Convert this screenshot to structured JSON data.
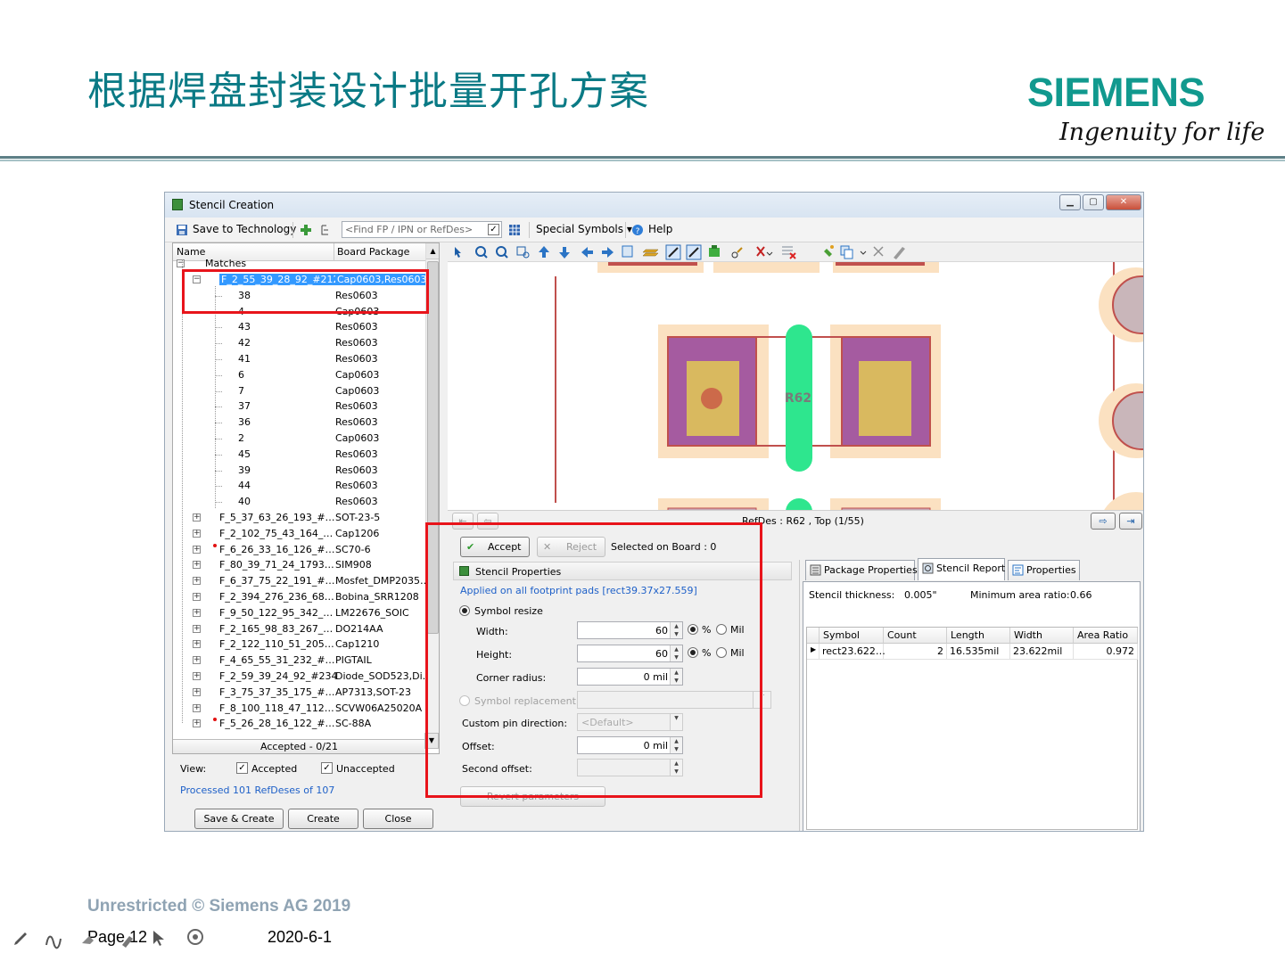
{
  "slide": {
    "title": "根据焊盘封装设计批量开孔方案",
    "logo": "SIEMENS",
    "tagline": "Ingenuity for life",
    "copyright": "Unrestricted © Siemens AG 2019",
    "page": "Page 12",
    "date": "2020-6-1"
  },
  "window": {
    "title": "Stencil Creation",
    "toolbar": {
      "save_tech": "Save to Technology",
      "find_placeholder": "<Find FP / IPN or RefDes>",
      "special_symbols": "Special Symbols",
      "help": "Help"
    }
  },
  "tree": {
    "col_name": "Name",
    "col_pkg": "Board Package",
    "root": "Matches",
    "selected": {
      "name": "F_2_55_39_28_92_#212",
      "pkg": "Cap0603,Res0603"
    },
    "children": [
      {
        "name": "38",
        "pkg": "Res0603"
      },
      {
        "name": "4",
        "pkg": "Cap0603"
      },
      {
        "name": "43",
        "pkg": "Res0603"
      },
      {
        "name": "42",
        "pkg": "Res0603"
      },
      {
        "name": "41",
        "pkg": "Res0603"
      },
      {
        "name": "6",
        "pkg": "Cap0603"
      },
      {
        "name": "7",
        "pkg": "Cap0603"
      },
      {
        "name": "37",
        "pkg": "Res0603"
      },
      {
        "name": "36",
        "pkg": "Res0603"
      },
      {
        "name": "2",
        "pkg": "Cap0603"
      },
      {
        "name": "45",
        "pkg": "Res0603"
      },
      {
        "name": "39",
        "pkg": "Res0603"
      },
      {
        "name": "44",
        "pkg": "Res0603"
      },
      {
        "name": "40",
        "pkg": "Res0603"
      }
    ],
    "groups": [
      {
        "name": "F_5_37_63_26_193_#…",
        "pkg": "SOT-23-5",
        "flag": false
      },
      {
        "name": "F_2_102_75_43_164_…",
        "pkg": "Cap1206",
        "flag": false
      },
      {
        "name": "F_6_26_33_16_126_#…",
        "pkg": "SC70-6",
        "flag": true
      },
      {
        "name": "F_80_39_71_24_1793…",
        "pkg": "SIM908",
        "flag": false
      },
      {
        "name": "F_6_37_75_22_191_#…",
        "pkg": "Mosfet_DMP2035…",
        "flag": false
      },
      {
        "name": "F_2_394_276_236_68…",
        "pkg": "Bobina_SRR1208",
        "flag": false
      },
      {
        "name": "F_9_50_122_95_342_…",
        "pkg": "LM22676_SOIC",
        "flag": false
      },
      {
        "name": "F_2_165_98_83_267_…",
        "pkg": "DO214AA",
        "flag": false
      },
      {
        "name": "F_2_122_110_51_205…",
        "pkg": "Cap1210",
        "flag": false
      },
      {
        "name": "F_4_65_55_31_232_#…",
        "pkg": "PIGTAIL",
        "flag": false
      },
      {
        "name": "F_2_59_39_24_92_#234",
        "pkg": "Diode_SOD523,Di…",
        "flag": false
      },
      {
        "name": "F_3_75_37_35_175_#…",
        "pkg": "AP7313,SOT-23",
        "flag": false
      },
      {
        "name": "F_8_100_118_47_112…",
        "pkg": "SCVW06A25020A",
        "flag": false
      },
      {
        "name": "F_5_26_28_16_122_#…",
        "pkg": "SC-88A",
        "flag": true
      }
    ],
    "footer": "Accepted - 0/21"
  },
  "view": {
    "label": "View:",
    "accepted": "Accepted",
    "unaccepted": "Unaccepted",
    "processed": "Processed 101 RefDeses of 107"
  },
  "buttons": {
    "save_create": "Save & Create",
    "create": "Create",
    "close": "Close",
    "accept": "Accept",
    "reject": "Reject",
    "revert": "Revert parameters"
  },
  "canvas": {
    "refdes_label": "R62",
    "nav_text": "RefDes : R62 , Top (1/55)",
    "colors": {
      "pad": "#a55ba0",
      "paste": "#d9b95f",
      "outline": "#fbe1c1",
      "trace": "#2ee68e",
      "board_edge": "#c0504d"
    }
  },
  "action_bar": {
    "selected_on_board": "Selected on Board : 0"
  },
  "stencil_props": {
    "header": "Stencil Properties",
    "applied": "Applied on all footprint pads [rect39.37x27.559]",
    "symbol_resize": "Symbol resize",
    "width_label": "Width:",
    "width_value": "60",
    "height_label": "Height:",
    "height_value": "60",
    "unit_pct": "%",
    "unit_mil": "Mil",
    "corner_label": "Corner radius:",
    "corner_value": "0 mil",
    "symbol_replacement": "Symbol replacement",
    "custom_pin_label": "Custom pin direction:",
    "custom_pin_value": "<Default>",
    "offset_label": "Offset:",
    "offset_value": "0 mil",
    "second_offset_label": "Second offset:"
  },
  "tabs": {
    "package_props": "Package Properties",
    "stencil_report": "Stencil Report",
    "properties": "Properties"
  },
  "report": {
    "thickness_label": "Stencil thickness:",
    "thickness_value": "0.005\"",
    "min_ratio_label": "Minimum area ratio:",
    "min_ratio_value": "0.66",
    "columns": [
      "Symbol",
      "Count",
      "Length",
      "Width",
      "Area Ratio"
    ],
    "row": [
      "rect23.622…",
      "2",
      "16.535mil",
      "23.622mil",
      "0.972"
    ]
  }
}
